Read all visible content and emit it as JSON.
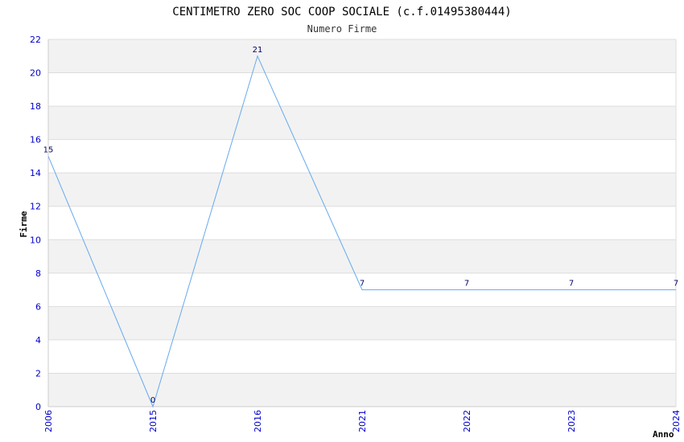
{
  "chart_data": {
    "type": "line",
    "title": "CENTIMETRO ZERO SOC COOP SOCIALE (c.f.01495380444)",
    "subtitle": "Numero Firme",
    "xlabel": "Anno",
    "ylabel": "Firme",
    "categories": [
      "2006",
      "2015",
      "2016",
      "2021",
      "2022",
      "2023",
      "2024"
    ],
    "series": [
      {
        "values": [
          15,
          0,
          21,
          7,
          7,
          7,
          7
        ]
      }
    ],
    "ylim": [
      0,
      22
    ],
    "yticks": [
      0,
      2,
      4,
      6,
      8,
      10,
      12,
      14,
      16,
      18,
      20,
      22
    ],
    "grid": true,
    "colors": {
      "line": "#66aaee",
      "band": "#f2f2f2",
      "grid": "#dddddd",
      "tick_text": "#0000cc",
      "data_label": "#000066"
    }
  }
}
